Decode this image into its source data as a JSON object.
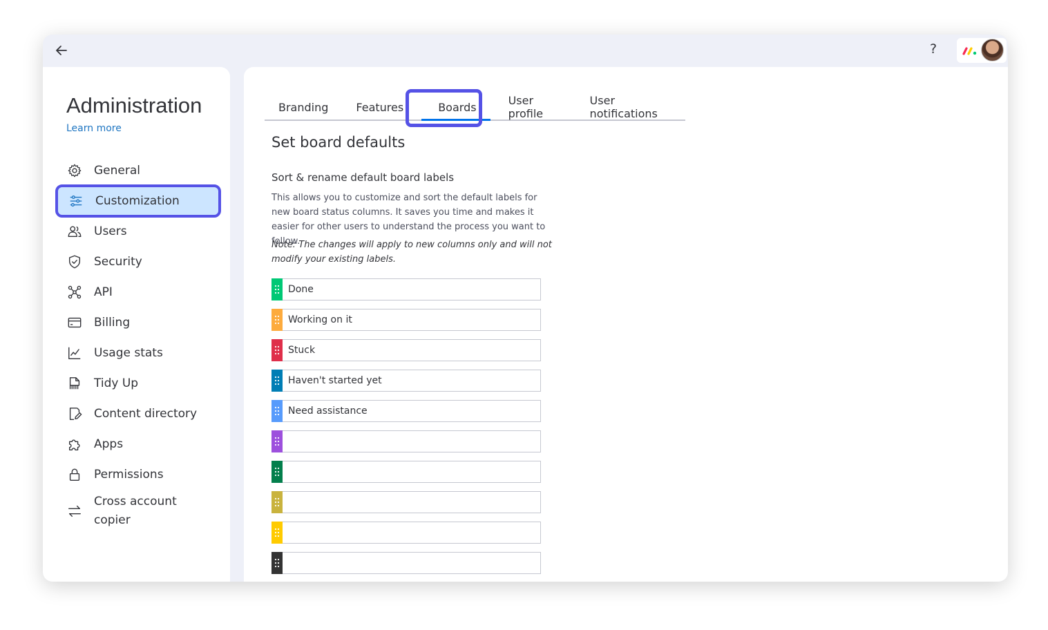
{
  "topbar": {
    "help_label": "?"
  },
  "sidebar": {
    "title": "Administration",
    "learn_more": "Learn more",
    "items": [
      {
        "label": "General"
      },
      {
        "label": "Customization"
      },
      {
        "label": "Users"
      },
      {
        "label": "Security"
      },
      {
        "label": "API"
      },
      {
        "label": "Billing"
      },
      {
        "label": "Usage stats"
      },
      {
        "label": "Tidy Up"
      },
      {
        "label": "Content directory"
      },
      {
        "label": "Apps"
      },
      {
        "label": "Permissions"
      },
      {
        "label_line1": "Cross account",
        "label_line2": "copier"
      }
    ]
  },
  "tabs": [
    {
      "label": "Branding"
    },
    {
      "label": "Features"
    },
    {
      "label": "Boards"
    },
    {
      "label": "User profile"
    },
    {
      "label": "User notifications"
    }
  ],
  "main": {
    "heading": "Set board defaults",
    "subheading": "Sort & rename default board labels",
    "description": "This allows you to customize and sort the default labels for new board status columns. It saves you time and makes it easier for other users to understand the process you want to follow.",
    "note": "Note: The changes will apply to new columns only and will not modify your existing labels."
  },
  "labels": [
    {
      "value": "Done",
      "color": "#00c875"
    },
    {
      "value": "Working on it",
      "color": "#fdab3d"
    },
    {
      "value": "Stuck",
      "color": "#df2f4a"
    },
    {
      "value": "Haven't started yet",
      "color": "#007eb5"
    },
    {
      "value": "Need assistance",
      "color": "#579bfc"
    },
    {
      "value": "",
      "color": "#9d50dd"
    },
    {
      "value": "",
      "color": "#037f4c"
    },
    {
      "value": "",
      "color": "#c9b33e"
    },
    {
      "value": "",
      "color": "#ffcb00"
    },
    {
      "value": "",
      "color": "#333333"
    }
  ]
}
